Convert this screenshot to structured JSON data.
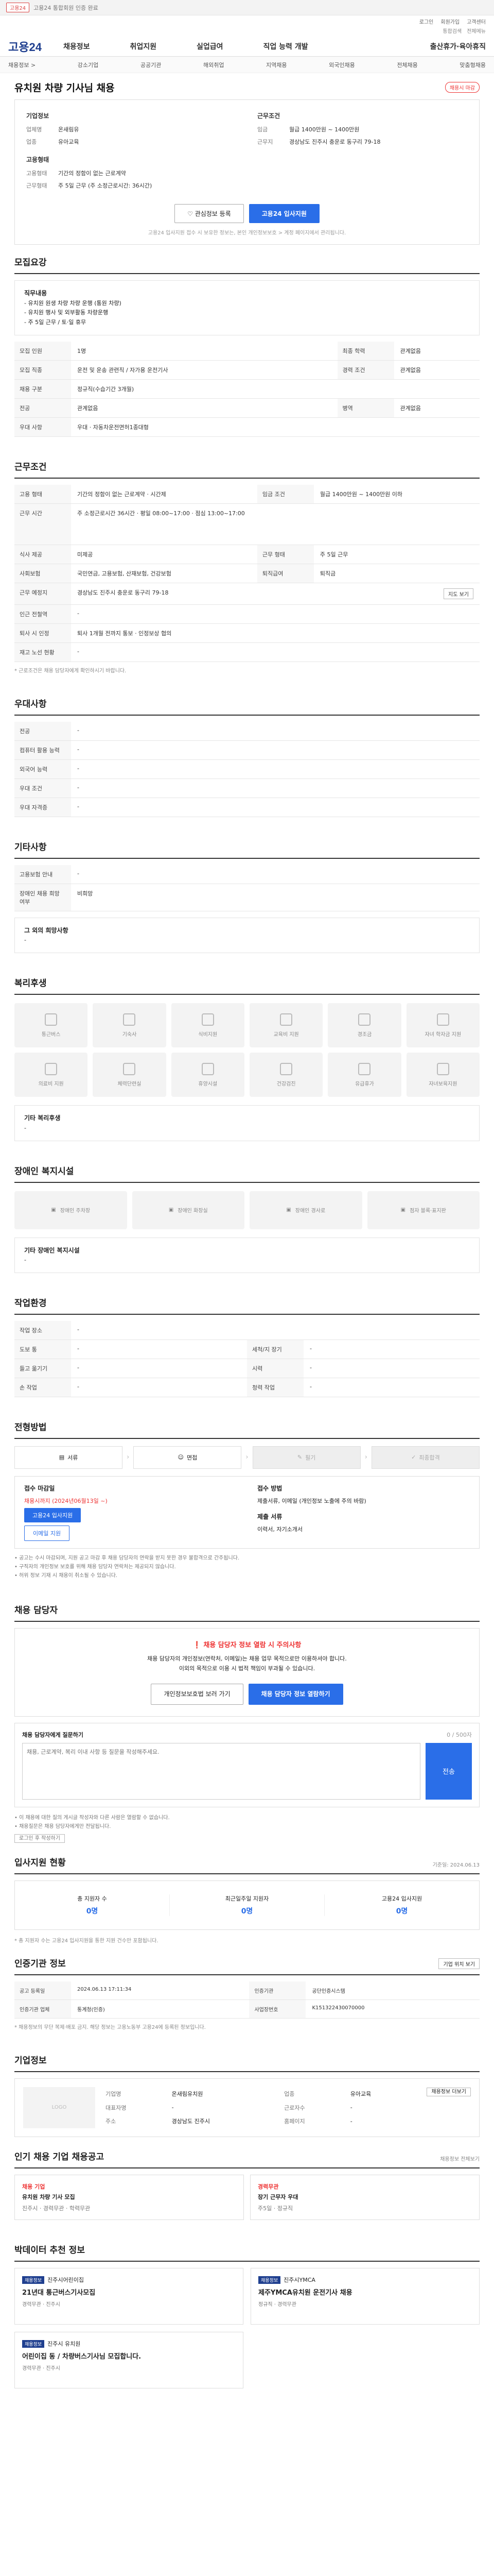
{
  "topbar": {
    "badge": "고용24",
    "text": "고용24 통합회원 인증 완료"
  },
  "util": {
    "links": [
      "로그인",
      "회원가입",
      "고객센터"
    ],
    "links2": [
      "통합검색",
      "전체메뉴"
    ]
  },
  "header": {
    "logo": "고용24",
    "gnb": [
      "채용정보",
      "취업지원",
      "실업급여",
      "직업 능력 개발",
      "출산휴가·육아휴직"
    ]
  },
  "subnav": [
    "채용정보 >",
    "강소기업",
    "공공기관",
    "해외취업",
    "지역채용",
    "외국인채용",
    "전체채용",
    "맞춤형채용"
  ],
  "job": {
    "title": "유치원 차량 기사님 채용",
    "status": "채용시 마감",
    "company_section": "기업정보",
    "company_name_label": "업체명",
    "company_name": "온새림유",
    "industry_label": "업종",
    "industry": "유아교육",
    "work_section": "근무조건",
    "wage_label": "임금",
    "wage": "월급 1400만원 ~ 1400만원",
    "location_label": "근무지",
    "location": "경상남도 진주시 충운로 동구리 79-18",
    "employment_section": "고용형태",
    "employment_label": "고용형태",
    "employment": "기간의 정함이 없는 근로계약",
    "workhours_label": "근무형태",
    "workhours": "주 5일 근무 (주 소정근로시간: 36시간)",
    "btn_interest": "관심정보 등록",
    "btn_apply": "고용24 입사지원",
    "notice": "고용24 입사지원 접수 시 보유한 정보는, 본인 개인정보보호 > 계정 페이지에서 관리됩니다."
  },
  "recruit": {
    "section": "모집요강",
    "duty_title": "직무내용",
    "duty_lines": [
      "- 유치원 원생 차량 차량 운행 (통원 차량)",
      "- 유치원 행사 및 외부활동 차량운행",
      "- 주 5일 근무 / 토·일 휴무"
    ],
    "rows": [
      {
        "k": "모집 인원",
        "v": "1명",
        "k2": "최종 학력",
        "v2": "관계없음"
      },
      {
        "k": "모집 직종",
        "v": "운전 및 운송 관련직 / 자가용 운전기사",
        "k2": "경력 조건",
        "v2": "관계없음"
      },
      {
        "k": "채용 구분",
        "v": "정규직(수습기간 3개월)",
        "k2": "",
        "v2": ""
      },
      {
        "k": "전공",
        "v": "관계없음",
        "k2": "병역",
        "v2": "관계없음"
      },
      {
        "k": "우대 사항",
        "v": "우대 · 자동차운전면허1종대형",
        "k2": "",
        "v2": ""
      }
    ]
  },
  "conditions": {
    "section": "근무조건",
    "rows": [
      {
        "k": "고용 형태",
        "v": "기간의 정함이 없는 근로계약 · 시간제",
        "k2": "임금 조건",
        "v2": "월급 1400만원 ~ 1400만원 이하"
      },
      {
        "k": "근무 시간",
        "v": "주 소정근로시간 36시간 · 평일 08:00~17:00 · 점심 13:00~17:00",
        "k2": "",
        "v2": ""
      },
      {
        "k": "식사 제공",
        "v": "미제공",
        "k2": "근무 형태",
        "v2": "주 5일 근무"
      },
      {
        "k": "사회보험",
        "v": "국민연금, 고용보험, 산재보험, 건강보험",
        "k2": "퇴직급여",
        "v2": "퇴직금"
      },
      {
        "k": "근무 예정지",
        "v": "경상남도 진주시 충운로 동구리 79-18",
        "k2": "",
        "v2": ""
      },
      {
        "k": "인근 전철역",
        "v": "-",
        "k2": "",
        "v2": ""
      },
      {
        "k": "퇴사 시 인정",
        "v": "퇴사 1개월 전까지 통보 · 인정보상 협의",
        "k2": "",
        "v2": ""
      },
      {
        "k": "재고 노선 현황",
        "v": "-",
        "k2": "",
        "v2": ""
      }
    ],
    "map_btn": "지도 보기",
    "note": "* 근로조건은 채용 담당자에게 확인하시기 바랍니다."
  },
  "pref": {
    "section": "우대사항",
    "rows": [
      {
        "k": "전공",
        "v": "-"
      },
      {
        "k": "컴퓨터 활용 능력",
        "v": "-"
      },
      {
        "k": "외국어 능력",
        "v": "-"
      },
      {
        "k": "우대 조건",
        "v": "-"
      },
      {
        "k": "우대 자격증",
        "v": "-"
      }
    ]
  },
  "etc": {
    "section": "기타사항",
    "rows": [
      {
        "k": "고용보험 안내",
        "v": "-"
      },
      {
        "k": "장애인 채용 희망 여부",
        "v": "비희망"
      }
    ],
    "extra_label": "그 외의 희망사항",
    "extra_value": "-"
  },
  "welfare": {
    "section": "복리후생",
    "items": [
      "통근버스",
      "기숙사",
      "식비지원",
      "교육비 지원",
      "경조금",
      "자녀 학자금 지원",
      "의료비 지원",
      "체력단련실",
      "휴양시설",
      "건강검진",
      "유급휴가",
      "자녀보육지원"
    ],
    "extra_label": "기타 복리후생",
    "extra_value": "-"
  },
  "disab": {
    "section": "장애인 복지시설",
    "items": [
      "장애인 주차장",
      "장애인 화장실",
      "장애인 경사로",
      "점자 블록·표지판"
    ],
    "extra_label": "기타 장애인 복지시설",
    "extra_value": "-"
  },
  "env": {
    "section": "작업환경",
    "rows": [
      {
        "k": "작업 장소",
        "v": "-",
        "k2": "",
        "v2": ""
      },
      {
        "k": "도보 통",
        "v": "-",
        "k2": "세척/지 장기",
        "v2": "-"
      },
      {
        "k": "들고 옮기기",
        "v": "-",
        "k2": "시력",
        "v2": "-"
      },
      {
        "k": "손 작업",
        "v": "-",
        "k2": "청력 작업",
        "v2": "-"
      }
    ]
  },
  "process": {
    "section": "전형방법",
    "steps": [
      "서류",
      "면접",
      "필기",
      "최종합격"
    ],
    "apply_title": "접수 마감일",
    "apply_deadline": "채용시까지 (2024년06월13일 ~)",
    "apply_btn1": "고용24 입사지원",
    "apply_btn2": "이메일 지원",
    "method_title": "접수 방법",
    "method_value": "제출서류, 이메일 (개인정보 노출에 주의 바람)",
    "doc_title": "제출 서류",
    "doc_value": "이력서, 자기소개서",
    "bullets": [
      "• 공고는 수시 마감되며, 지원 공고 마감 후 채용 담당자의 연락을 받지 못한 경우 불합격으로 간주됩니다.",
      "• 구직자의 개인정보 보호를 위해 채용 담당자 연락처는 제공되지 않습니다.",
      "• 허위 정보 기재 시 채용이 취소될 수 있습니다."
    ]
  },
  "contact": {
    "section": "채용 담당자",
    "warn": "채용 담당자 정보 열람 시 주의사항",
    "line1": "채용 담당자의 개인정보(연락처, 이메일)는 채용 업무 목적으로만 이용하셔야 합니다.",
    "line2": "이외의 목적으로 이용 시 법적 책임이 부과될 수 있습니다.",
    "btn1": "개인정보보호법 보러 가기",
    "btn2": "채용 담당자 정보 열람하기"
  },
  "qna": {
    "label": "채용 담당자에게 질문하기",
    "counter": "0 / 500자",
    "placeholder": "채용, 근로계약, 복리 이내 사항 등 질문을 작성해주세요.",
    "send": "전송",
    "notes": [
      "• 이 채용에 대한 질의 게시글 작성자와 다른 사람은 열람할 수 없습니다.",
      "• 채용질문은 채용 담당자에게만 전달됩니다."
    ],
    "login_btn": "로그인 후 작성하기"
  },
  "stats": {
    "section": "입사지원 현황",
    "date": "기준일: 2024.06.13",
    "items": [
      {
        "label": "총 지원자 수",
        "value": "0명"
      },
      {
        "label": "최근일주일 지원자",
        "value": "0명"
      },
      {
        "label": "고용24 입사지원",
        "value": "0명"
      }
    ],
    "note": "* 총 지원자 수는 고용24 입사지원을 통한 지원 건수만 포함됩니다."
  },
  "cert": {
    "section": "인증기관 정보",
    "map_btn": "기업 위치 보기",
    "rows": [
      {
        "k": "공고 등록일",
        "v": "2024.06.13 17:11:34",
        "k2": "인증기관",
        "v2": "공단인증시스템"
      },
      {
        "k": "인증기관 업체",
        "v": "통계청(인증)",
        "k2": "사업장번호",
        "v2": "K151322430070000"
      }
    ],
    "note": "* 채용정보의 무단 복제·배포 금지. 해당 정보는 고용노동부 고용24에 등록된 정보입니다."
  },
  "company": {
    "section": "기업정보",
    "logo_text": "LOGO",
    "rows": [
      {
        "k": "기업명",
        "v": "온새림유치원",
        "k2": "업종",
        "v2": "유아교육"
      },
      {
        "k": "대표자명",
        "v": "-",
        "k2": "근로자수",
        "v2": "-"
      },
      {
        "k": "주소",
        "v": "경상남도 진주시",
        "k2": "홈페이지",
        "v2": "-"
      }
    ],
    "btn": "채용정보 더보기"
  },
  "others": {
    "section": "인기 채용 기업 채용공고",
    "link": "채용정보 전체보기",
    "cards": [
      {
        "co": "채용 기업",
        "title": "유치원 차량 기사 모집",
        "meta": "진주시 · 경력무관 · 학력무관"
      },
      {
        "co": "경력무관",
        "title": "장기 근무자 우대",
        "meta": "주5일 · 정규직"
      }
    ]
  },
  "recs": {
    "section": "박데이터 추천 정보",
    "cards": [
      {
        "badge": "채용정보",
        "org": "진주시어린이집",
        "title": "21년대 통근버스기사모집",
        "meta": "경력무관 · 진주시"
      },
      {
        "badge": "채용정보",
        "org": "진주시YMCA",
        "title": "제주YMCA유치원 운전기사 채용",
        "meta": "정규직 · 경력무관"
      },
      {
        "badge": "채용정보",
        "org": "진주시 유치원",
        "title": "어린이집 동 / 차량버스기사님 모집합니다.",
        "meta": "경력무관 · 진주시"
      }
    ]
  }
}
